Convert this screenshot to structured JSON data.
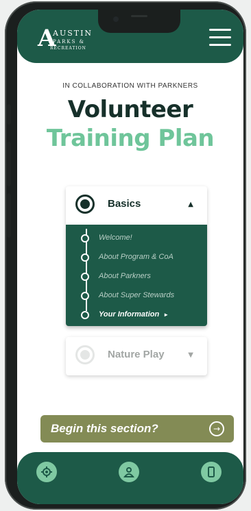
{
  "header": {
    "logo": {
      "mark": "A",
      "line1": "AUSTIN",
      "line2": "PARKS &",
      "line3": "RECREATION"
    },
    "menu_icon": "hamburger-icon"
  },
  "intro": {
    "collab_text": "IN COLLABORATION WITH PARKNERS",
    "title_line1": "Volunteer",
    "title_line2": "Training Plan"
  },
  "sections": [
    {
      "label": "Basics",
      "expanded": true,
      "caret": "▲",
      "items": [
        {
          "label": "Welcome!"
        },
        {
          "label": "About Program & CoA"
        },
        {
          "label": "About Parkners"
        },
        {
          "label": "About Super Stewards"
        },
        {
          "label": "Your Information",
          "active": true,
          "arrow": "►"
        }
      ]
    },
    {
      "label": "Nature Play",
      "expanded": false,
      "caret": "▼"
    }
  ],
  "cta": {
    "label": "Begin this section?",
    "icon": "arrow-right-circle-icon",
    "arrow": "→"
  },
  "bottom_nav": [
    {
      "icon": "gear-icon"
    },
    {
      "icon": "user-icon"
    },
    {
      "icon": "phone-icon"
    }
  ],
  "colors": {
    "brand_green": "#1d5a48",
    "title_dark": "#16302a",
    "title_accent": "#6fc59a",
    "cta_olive": "#838b55",
    "icon_mint": "#7fc9a2"
  }
}
